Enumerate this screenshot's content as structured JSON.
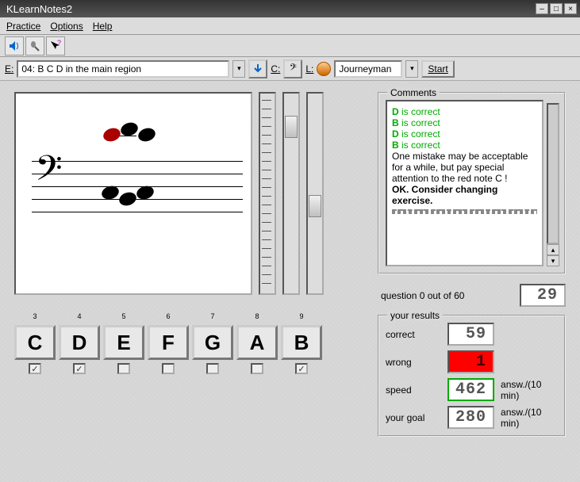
{
  "window": {
    "title": "KLearnNotes2"
  },
  "menu": {
    "practice": "Practice",
    "options": "Options",
    "help": "Help"
  },
  "exercise_bar": {
    "e_label": "E:",
    "exercise": "04: B C D in the main region",
    "c_label": "C:",
    "l_label": "L:",
    "level": "Journeyman",
    "start": "Start"
  },
  "note_buttons": [
    {
      "digit": "3",
      "label": "C",
      "checked": true
    },
    {
      "digit": "4",
      "label": "D",
      "checked": true
    },
    {
      "digit": "5",
      "label": "E",
      "checked": false
    },
    {
      "digit": "6",
      "label": "F",
      "checked": false
    },
    {
      "digit": "7",
      "label": "G",
      "checked": false
    },
    {
      "digit": "8",
      "label": "A",
      "checked": false
    },
    {
      "digit": "9",
      "label": "B",
      "checked": true
    }
  ],
  "comments": {
    "legend": "Comments",
    "lines": [
      {
        "note": "D",
        "text": " is correct"
      },
      {
        "note": "B",
        "text": " is correct"
      },
      {
        "note": "D",
        "text": " is correct"
      },
      {
        "note": "B",
        "text": " is correct"
      }
    ],
    "info": "One mistake may be acceptable for a while, but pay special attention to the red note C !",
    "final": "OK. Consider changing exercise."
  },
  "question": {
    "label": "question 0 out of 60",
    "timer": "29"
  },
  "results": {
    "legend": "your results",
    "correct_label": "correct",
    "correct": "59",
    "wrong_label": "wrong",
    "wrong": "1",
    "speed_label": "speed",
    "speed": "462",
    "speed_unit": "answ./(10 min)",
    "goal_label": "your goal",
    "goal": "280",
    "goal_unit": "answ./(10 min)"
  }
}
